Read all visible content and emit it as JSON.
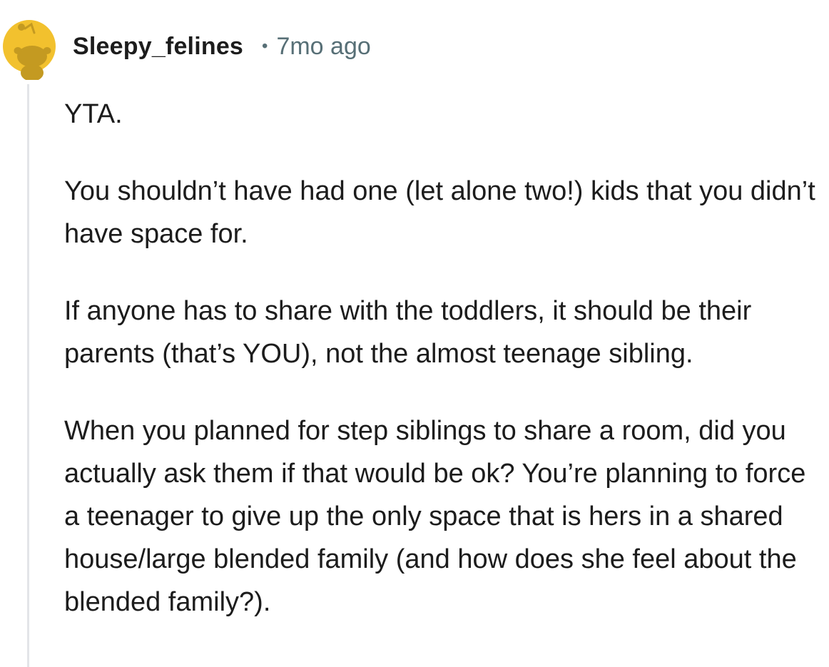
{
  "comment": {
    "author": "Sleepy_felines",
    "separator": "•",
    "timestamp": "7mo ago",
    "avatar_icon": "snoo-avatar-icon",
    "avatar_color": "#f2c12e",
    "paragraphs": [
      "YTA.",
      "You shouldn’t have had one (let alone two!) kids that you didn’t have space for.",
      "If anyone has to share with the toddlers, it should be their parents (that’s YOU), not the almost teenage sibling.",
      "When you planned for step siblings to share a room, did you actually ask them if that would be ok? You’re planning to force a teenager to give up the only space that is hers in a shared house/large blended family (and how does she feel about the blended family?)."
    ]
  }
}
